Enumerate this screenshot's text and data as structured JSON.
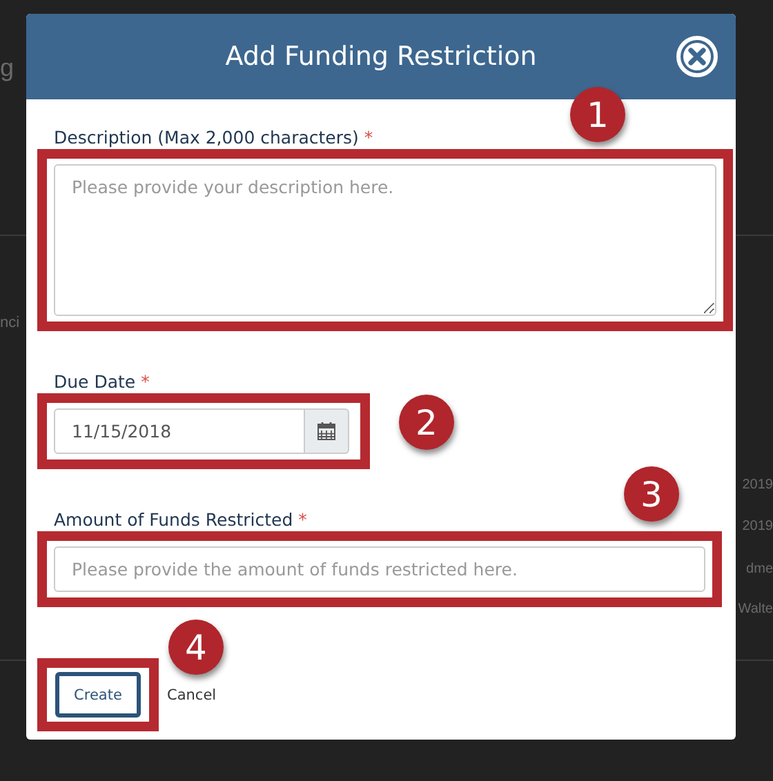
{
  "background_fragments": [
    {
      "text": "g"
    },
    {
      "text": "nci"
    },
    {
      "text": "2019"
    },
    {
      "text": "2019"
    },
    {
      "text": "dme"
    },
    {
      "text": "Walte"
    }
  ],
  "dialog": {
    "title": "Add Funding Restriction",
    "fields": [
      {
        "kind": "textarea",
        "label": "Description (Max 2,000 characters)",
        "required_mark": "*",
        "placeholder": "Please provide your description here.",
        "callout": "1"
      },
      {
        "kind": "date",
        "label": "Due Date",
        "required_mark": "*",
        "value": "11/15/2018",
        "callout": "2"
      },
      {
        "kind": "text",
        "label": "Amount of Funds Restricted",
        "required_mark": "*",
        "placeholder": "Please provide the amount of funds restricted here.",
        "callout": "3"
      }
    ],
    "buttons": [
      {
        "kind": "primary",
        "label": "Create"
      },
      {
        "kind": "link",
        "label": "Cancel"
      }
    ],
    "buttons_callout": "4"
  }
}
